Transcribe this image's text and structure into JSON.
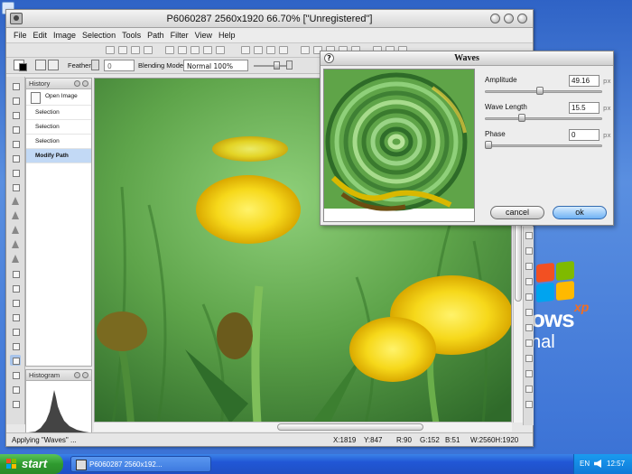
{
  "window": {
    "title": "P6060287 2560x1920 66.70% [\"Unregistered\"]",
    "menu": [
      "File",
      "Edit",
      "Image",
      "Selection",
      "Tools",
      "Path",
      "Filter",
      "View",
      "Help"
    ]
  },
  "options_bar": {
    "feather_label": "Feather",
    "feather_value": "0",
    "blending_label": "Blending Mode:",
    "blending_value": "Normal 100%"
  },
  "history_panel": {
    "title": "History",
    "items": [
      "Open Image",
      "Selection",
      "Selection",
      "Selection",
      "Modify Path"
    ],
    "active_index": 4
  },
  "histogram_panel": {
    "title": "Histogram"
  },
  "status_bar": {
    "message": "Applying \"Waves\" ...",
    "x": "X:1819",
    "y": "Y:847",
    "r": "R:90",
    "g": "G:152",
    "b": "B:51",
    "size": "W:2560H:1920"
  },
  "waves_dialog": {
    "title": "Waves",
    "help_glyph": "?",
    "params": [
      {
        "label": "Amplitude",
        "value": "49.16",
        "unit": "px",
        "slider_fraction": 0.47
      },
      {
        "label": "Wave Length",
        "value": "15.5",
        "unit": "px",
        "slider_fraction": 0.3
      },
      {
        "label": "Phase",
        "value": "0",
        "unit": "px",
        "slider_fraction": 0.0
      }
    ],
    "cancel_label": "cancel",
    "ok_label": "ok"
  },
  "desktop": {
    "brand_word": "ows",
    "brand_xp": "xp",
    "brand_sub": "nal"
  },
  "taskbar": {
    "start_label": "start",
    "task_label": "P6060287 2560x192...",
    "lang": "EN",
    "clock": "12:57"
  },
  "colors": {
    "accent_selection": "#c2d9f5",
    "ok_button": "#6fb2f4",
    "taskbar": "#2157d6",
    "start_button": "#2f9a2f"
  }
}
